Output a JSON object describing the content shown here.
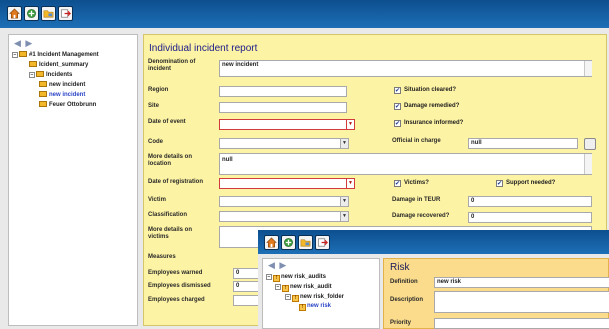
{
  "colors": {
    "toolbar": "#1d6fb6",
    "form_bg": "#fdf3a4",
    "risk_bg": "#fbdc8c",
    "required_border": "#d23b3b",
    "selected_tree": "#2a44c6"
  },
  "toolbar": {
    "icons": [
      "home-icon",
      "tree-add-icon",
      "folder-icon",
      "export-icon"
    ]
  },
  "tree": {
    "nav": "◀ ▶",
    "nodes": [
      "#1 Incident Management",
      "Icident_summary",
      "Incidents",
      "new incident",
      "new incident",
      "Feuer Ottobrunn"
    ]
  },
  "form": {
    "title": "Individual incident report",
    "fields": {
      "denomination": {
        "label": "Denomination of incident",
        "value": "new incident"
      },
      "region": {
        "label": "Region",
        "value": ""
      },
      "site": {
        "label": "Site",
        "value": ""
      },
      "date_of_event": {
        "label": "Date of event",
        "value": ""
      },
      "code": {
        "label": "Code",
        "value": ""
      },
      "more_details_location": {
        "label": "More details on location",
        "value": "null"
      },
      "date_of_registration": {
        "label": "Date of registration",
        "value": ""
      },
      "victim": {
        "label": "Victim",
        "value": ""
      },
      "classification": {
        "label": "Classification",
        "value": ""
      },
      "more_details_victims": {
        "label": "More details on victims",
        "value": ""
      },
      "measures": {
        "label": "Measures"
      },
      "employees_warned": {
        "label": "Employees warned",
        "value": "0"
      },
      "employees_dismissed": {
        "label": "Employees dismissed",
        "value": "0"
      },
      "employees_charged": {
        "label": "Employees charged",
        "value": ""
      },
      "official_in_charge": {
        "label": "Official in charge",
        "value": "null"
      },
      "damage_in_teur": {
        "label": "Damage in TEUR",
        "value": "0"
      },
      "damage_recovered": {
        "label": "Damage recovered?",
        "value": "0"
      }
    },
    "checkboxes": {
      "situation_cleared": {
        "label": "Situation cleared?",
        "mark": "✔"
      },
      "damage_remedied": {
        "label": "Damage remedied?",
        "mark": "✔"
      },
      "insurance_informed": {
        "label": "Insurance informed?",
        "mark": "✔"
      },
      "victims": {
        "label": "Victims?",
        "mark": "✔"
      },
      "support_needed": {
        "label": "Support needed?",
        "mark": "✔"
      }
    },
    "dropdown_arrow": "▼"
  },
  "risk_window": {
    "nav": "◀ ▶",
    "tree_nodes": [
      "new risk_audits",
      "new risk_audit",
      "new risk_folder",
      "new risk"
    ],
    "title": "Risk",
    "definition": {
      "label": "Definition",
      "value": "new risk"
    },
    "description": {
      "label": "Description",
      "value": ""
    },
    "priority": {
      "label": "Priority",
      "value": ""
    }
  }
}
